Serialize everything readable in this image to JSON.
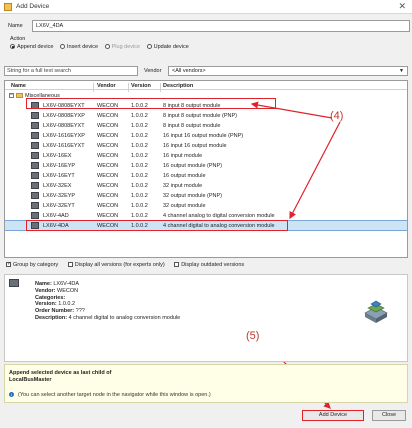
{
  "window": {
    "title": "Add Device",
    "close_glyph": "✕"
  },
  "name_field": {
    "label": "Name",
    "value": "LX6V_4DA"
  },
  "action": {
    "label": "Action",
    "options": [
      {
        "label": "Append device",
        "selected": true,
        "enabled": true
      },
      {
        "label": "Insert device",
        "selected": false,
        "enabled": true
      },
      {
        "label": "Plug device",
        "selected": false,
        "enabled": false
      },
      {
        "label": "Update device",
        "selected": false,
        "enabled": true
      }
    ]
  },
  "search": {
    "placeholder": "String for a full text search"
  },
  "vendor_filter": {
    "label": "Vendor",
    "value": "<All vendors>"
  },
  "tree": {
    "columns": {
      "name": "Name",
      "vendor": "Vendor",
      "version": "Version",
      "description": "Description"
    },
    "category": "Miscellaneous",
    "devices": [
      {
        "name": "LX6V-0808EYXT",
        "vendor": "WECON",
        "version": "1.0.0.2",
        "description": "8 input 8 output module"
      },
      {
        "name": "LX6V-0808EYXP",
        "vendor": "WECON",
        "version": "1.0.0.2",
        "description": "8 input 8 output module (PNP)"
      },
      {
        "name": "LX6V-0808EYXT",
        "vendor": "WECON",
        "version": "1.0.0.2",
        "description": "8 input 8 output module"
      },
      {
        "name": "LX6V-1616EYXP",
        "vendor": "WECON",
        "version": "1.0.0.2",
        "description": "16 input 16 output module (PNP)"
      },
      {
        "name": "LX6V-1616EYXT",
        "vendor": "WECON",
        "version": "1.0.0.2",
        "description": "16 input 16 output module"
      },
      {
        "name": "LX6V-16EX",
        "vendor": "WECON",
        "version": "1.0.0.2",
        "description": "16 input module"
      },
      {
        "name": "LX6V-16EYP",
        "vendor": "WECON",
        "version": "1.0.0.2",
        "description": "16 output module (PNP)"
      },
      {
        "name": "LX6V-16EYT",
        "vendor": "WECON",
        "version": "1.0.0.2",
        "description": "16 output module"
      },
      {
        "name": "LX6V-32EX",
        "vendor": "WECON",
        "version": "1.0.0.2",
        "description": "32 input module"
      },
      {
        "name": "LX6V-32EYP",
        "vendor": "WECON",
        "version": "1.0.0.2",
        "description": "32 output module (PNP)"
      },
      {
        "name": "LX6V-32EYT",
        "vendor": "WECON",
        "version": "1.0.0.2",
        "description": "32 output module"
      },
      {
        "name": "LX6V-4AD",
        "vendor": "WECON",
        "version": "1.0.0.2",
        "description": "4 channel analog to digital conversion module"
      },
      {
        "name": "LX6V-4DA",
        "vendor": "WECON",
        "version": "1.0.0.2",
        "description": "4 channel digital to analog conversion module",
        "selected": true
      }
    ]
  },
  "options": [
    {
      "label": "Group by category",
      "checked": true
    },
    {
      "label": "Display all versions (for experts only)",
      "checked": false
    },
    {
      "label": "Display outdated versions",
      "checked": false
    }
  ],
  "details": {
    "name_label": "Name:",
    "name": "LX6V-4DA",
    "vendor_label": "Vendor:",
    "vendor": "WECON",
    "categories_label": "Categories:",
    "categories": "",
    "version_label": "Version:",
    "version": "1.0.0.2",
    "order_label": "Order Number:",
    "order": "???",
    "description_label": "Description:",
    "description": "4 channel digital to analog conversion module"
  },
  "parent": {
    "line1": "Append selected device as last child of",
    "line2": "LocalBusMaster",
    "hint": "(You can select another target node in the navigator while this window is open.)"
  },
  "buttons": {
    "add": "Add Device",
    "close": "Close"
  },
  "annotations": {
    "a4": "(4)",
    "a5": "(5)"
  }
}
